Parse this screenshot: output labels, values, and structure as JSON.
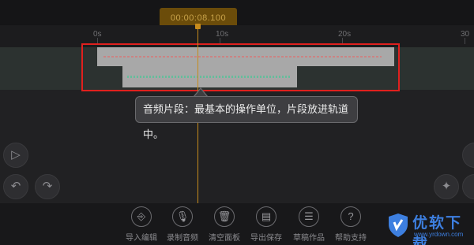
{
  "timecode": "00:00:08.100",
  "ruler": {
    "ticks": [
      "0s",
      "10s",
      "20s",
      "30"
    ]
  },
  "tooltip": {
    "text": "音频片段：最基本的操作单位，片段放进轨道中。"
  },
  "controls": {
    "play_icon": "play-icon",
    "undo_icon": "undo-icon",
    "redo_icon": "redo-icon",
    "effect_icon": "magic-wand-icon"
  },
  "toolbar": {
    "items": [
      {
        "label": "导入编辑",
        "icon": "import-icon"
      },
      {
        "label": "录制音频",
        "icon": "microphone-icon"
      },
      {
        "label": "清空面板",
        "icon": "trash-icon"
      },
      {
        "label": "导出保存",
        "icon": "save-icon"
      },
      {
        "label": "草稿作品",
        "icon": "list-icon"
      },
      {
        "label": "帮助支持",
        "icon": "help-icon"
      }
    ]
  },
  "watermark": {
    "title": "优软下载",
    "url": "www.yrdown.com"
  },
  "colors": {
    "accent": "#c78b1c",
    "highlight": "#e0201e",
    "brand": "#3d7fe0"
  }
}
